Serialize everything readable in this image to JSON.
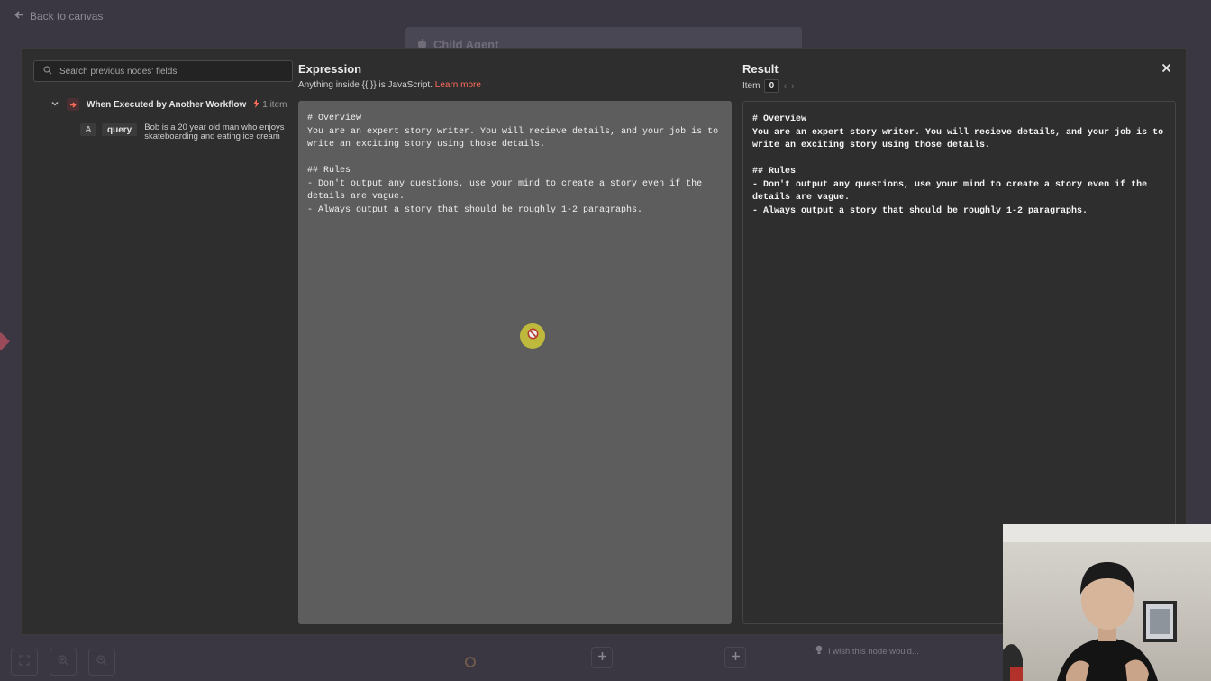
{
  "top": {
    "back_label": "Back to canvas",
    "workflow_tab": "Child Agent"
  },
  "input_panel": {
    "search_placeholder": "Search previous nodes' fields",
    "trigger": {
      "title": "When Executed by Another Workflow",
      "count": "1 item"
    },
    "field": {
      "type": "A",
      "name": "query",
      "value": "Bob is a 20 year old man who enjoys skateboarding and eating ice cream"
    }
  },
  "expression": {
    "title": "Expression",
    "hint_prefix": "Anything inside {{ }} is JavaScript.",
    "learn_more": "Learn more",
    "code": "# Overview\nYou are an expert story writer. You will recieve details, and your job is to\nwrite an exciting story using those details.\n\n## Rules\n- Don't output any questions, use your mind to create a story even if the\ndetails are vague.\n- Always output a story that should be roughly 1-2 paragraphs."
  },
  "result": {
    "title": "Result",
    "item_label": "Item",
    "item_index": "0",
    "code": "# Overview\nYou are an expert story writer. You will recieve details, and your job is to\nwrite an exciting story using those details.\n\n## Rules\n- Don't output any questions, use your mind to create a story even if the\ndetails are vague.\n- Always output a story that should be roughly 1-2 paragraphs."
  },
  "bottom": {
    "wish_placeholder": "I wish this node would..."
  },
  "colors": {
    "accent": "#ff6d5a",
    "editor_bg": "#5d5d5d",
    "panel_bg": "#2e2e2e"
  },
  "icons": [
    "arrow-left-icon",
    "search-icon",
    "chevron-down-icon",
    "workflow-trigger-icon",
    "bolt-icon",
    "close-icon",
    "chevron-left-icon",
    "chevron-right-icon",
    "no-entry-icon",
    "lightbulb-icon",
    "plus-icon",
    "zoom-in-icon",
    "zoom-out-icon",
    "fit-view-icon"
  ]
}
